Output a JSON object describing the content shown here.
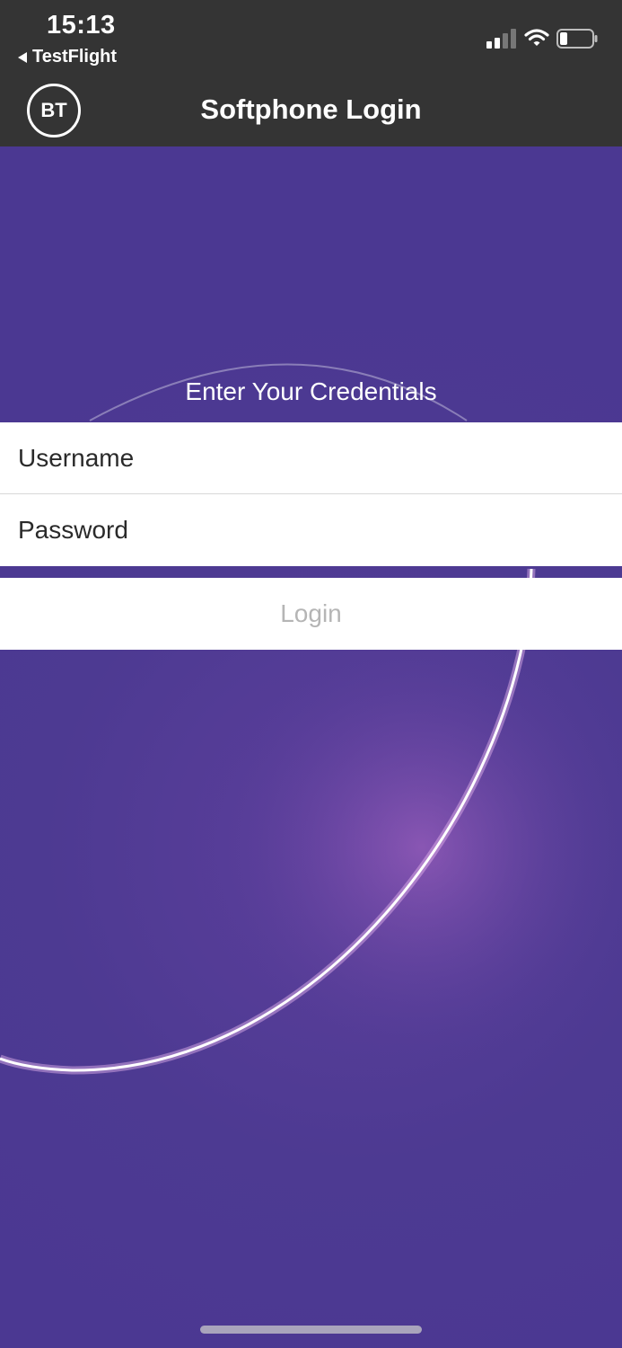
{
  "status_bar": {
    "time": "15:13",
    "back_app": "TestFlight"
  },
  "nav": {
    "logo_text": "BT",
    "title": "Softphone Login"
  },
  "form": {
    "heading": "Enter Your Credentials",
    "username_placeholder": "Username",
    "password_placeholder": "Password",
    "login_label": "Login"
  },
  "colors": {
    "background": "#4b3892",
    "bars": "#343434",
    "login_text_disabled": "#b5b5b5"
  }
}
